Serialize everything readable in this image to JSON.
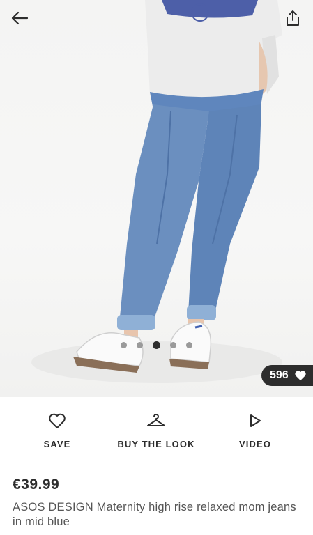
{
  "header": {
    "back_icon": "arrow-left-icon",
    "share_icon": "share-icon"
  },
  "gallery": {
    "image_alt": "Model wearing mid blue relaxed mom jeans with white sneakers",
    "total_images": 5,
    "active_index": 2,
    "likes_count": "596",
    "likes_icon": "heart-filled-icon"
  },
  "actions": {
    "save_label": "SAVE",
    "save_icon": "heart-outline-icon",
    "buy_the_look_label": "BUY THE LOOK",
    "buy_the_look_icon": "hanger-icon",
    "video_label": "VIDEO",
    "video_icon": "play-outline-icon"
  },
  "product": {
    "price": "€39.99",
    "title": "ASOS DESIGN Maternity high rise relaxed mom jeans in mid blue"
  },
  "colors": {
    "text": "#2d2d2d",
    "muted": "#555555",
    "badge_bg": "#2d2d2d",
    "denim": "#6b8fbf"
  }
}
